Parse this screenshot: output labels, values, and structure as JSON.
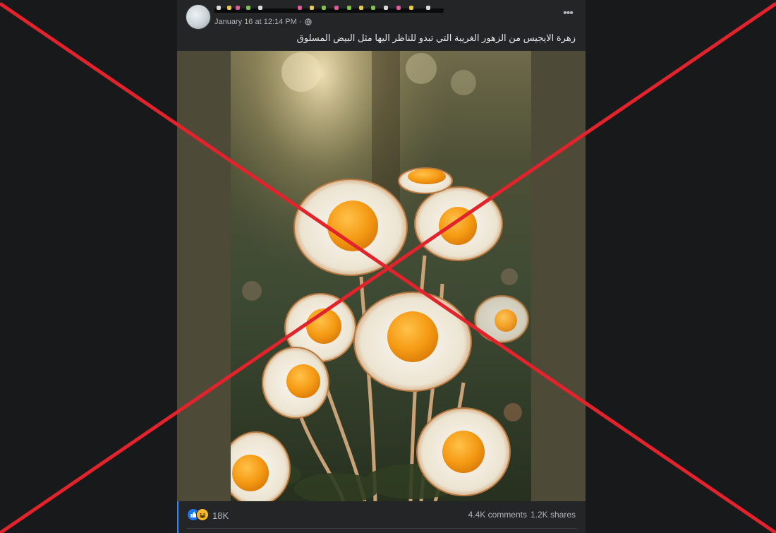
{
  "post": {
    "timestamp": "January 16 at 12:14 PM ·",
    "text": "زهرة الايجيس من الزهور الغريبة التي تبدو للناظر اليها مثل البيض المسلوق",
    "more_icon": "more-horizontal-icon",
    "privacy_icon": "globe-icon",
    "reactions": {
      "icons": [
        "like-icon",
        "haha-icon"
      ],
      "count": "18K"
    },
    "comments": "4.4K comments",
    "shares": "1.2K shares"
  },
  "overlay": {
    "type": "red-x-mark",
    "color": "#e3232c"
  },
  "colors": {
    "background": "#18191a",
    "card": "#242526",
    "text_primary": "#e4e6eb",
    "text_secondary": "#b0b3b8",
    "like_blue": "#1877f2"
  }
}
